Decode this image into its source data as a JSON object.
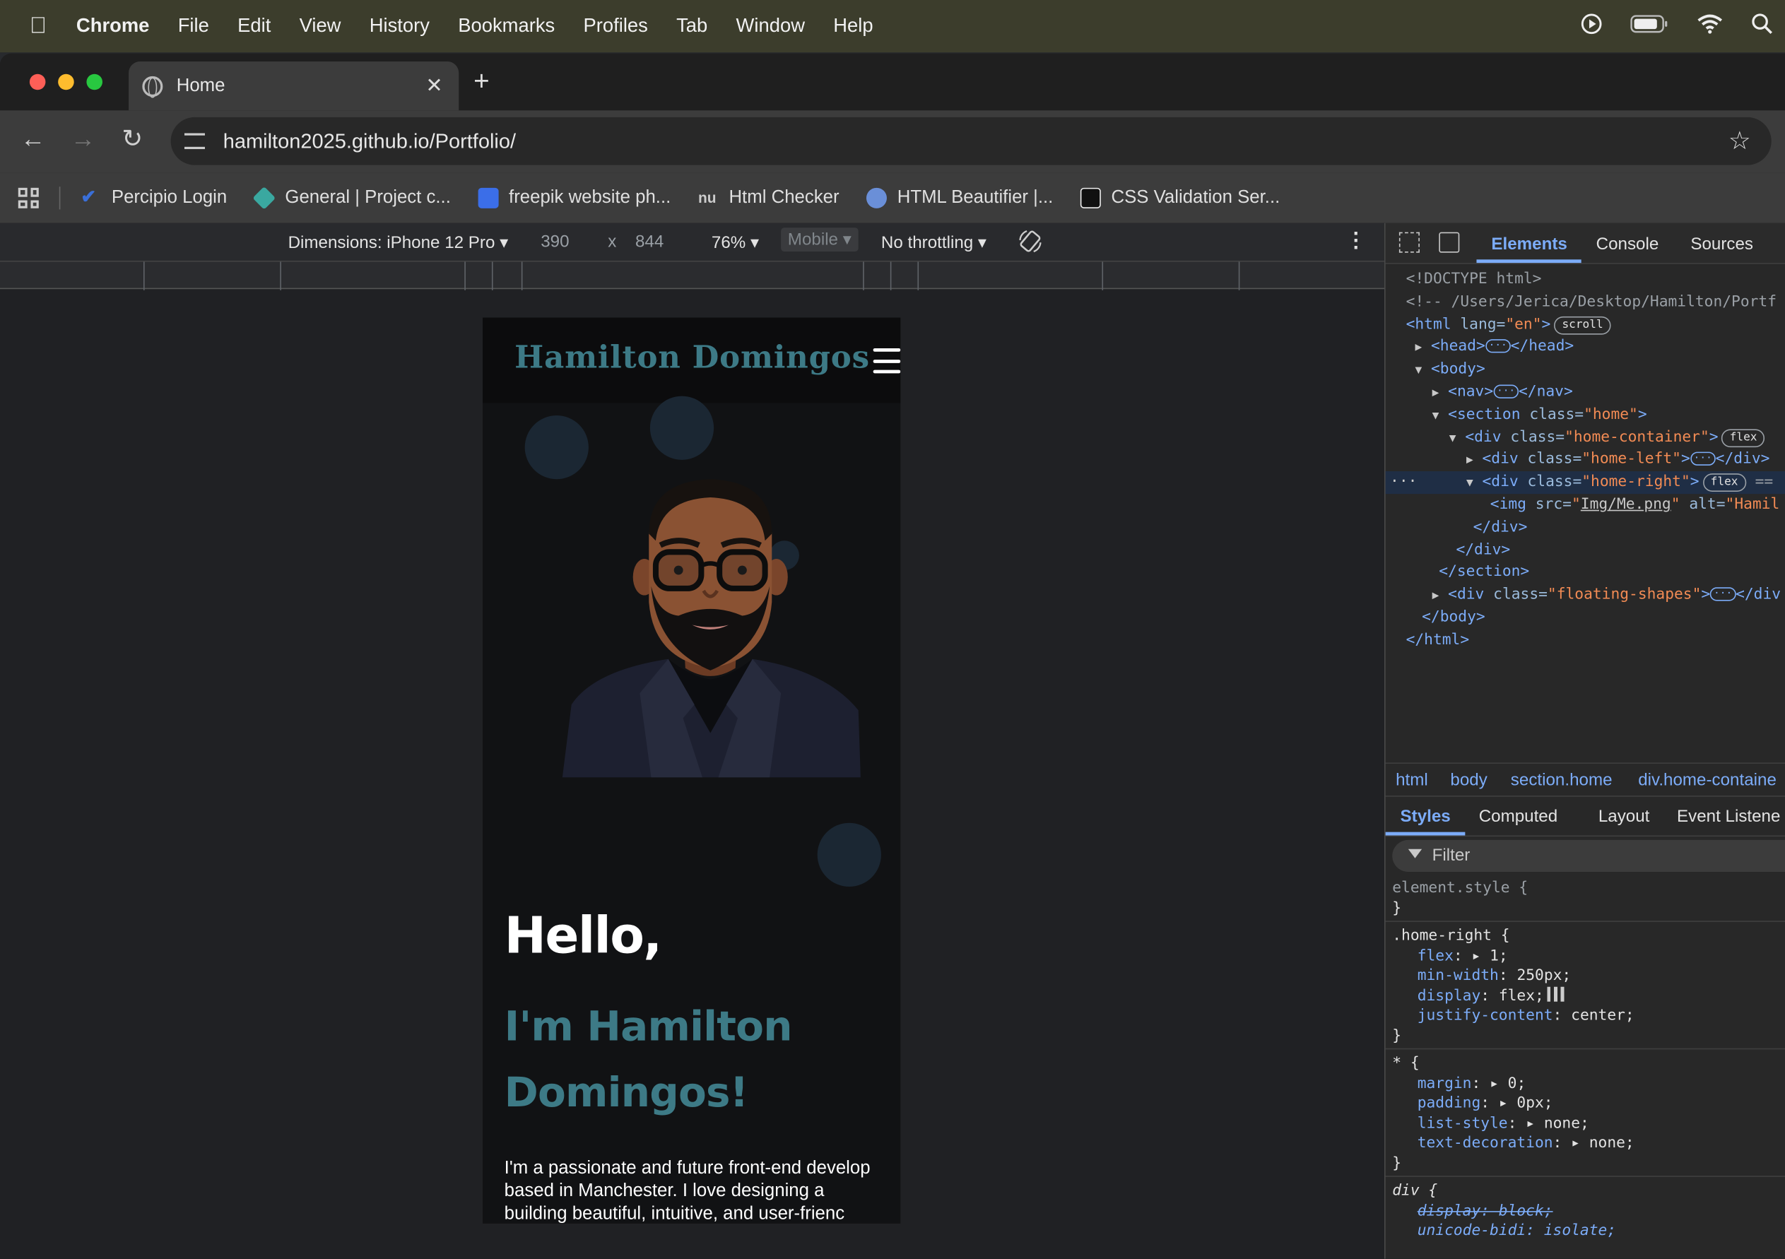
{
  "menubar": {
    "app": "Chrome",
    "items": [
      "File",
      "Edit",
      "View",
      "History",
      "Bookmarks",
      "Profiles",
      "Tab",
      "Window",
      "Help"
    ]
  },
  "tab": {
    "title": "Home"
  },
  "omnibox": {
    "url": "hamilton2025.github.io/Portfolio/"
  },
  "bookmarks": [
    {
      "label": "Percipio Login",
      "color": "#3a6fd8"
    },
    {
      "label": "General | Project c...",
      "color": "#3aa8a0"
    },
    {
      "label": "freepik website ph...",
      "color": "#3b6ee8"
    },
    {
      "label": "Html Checker",
      "color": "#1a1a2a"
    },
    {
      "label": "HTML Beautifier |...",
      "color": "#6a8fd8"
    },
    {
      "label": "CSS Validation Ser...",
      "color": "#111111"
    }
  ],
  "device_toolbar": {
    "dimensions_label": "Dimensions: iPhone 12 Pro",
    "width": "390",
    "times": "x",
    "height": "844",
    "zoom": "76%",
    "device_type": "Mobile",
    "throttling": "No throttling"
  },
  "page": {
    "logo": "Hamilton Domingos",
    "hello": "Hello,",
    "name_line": "I'm Hamilton Domingos!",
    "intro_lines": [
      "I'm a passionate and future front-end develop",
      "based in Manchester. I love designing a",
      "building beautiful, intuitive, and user-frienc"
    ],
    "accent_color": "#3d7a86"
  },
  "devtools": {
    "tabs": [
      "Elements",
      "Console",
      "Sources"
    ],
    "dom": {
      "doctype": "<!DOCTYPE html>",
      "comment": "<!-- /Users/Jerica/Desktop/Hamilton/Portf",
      "html_open": "<html",
      "html_attr": "lang",
      "html_val": "\"en\"",
      "html_end": ">",
      "scroll_badge": "scroll",
      "head": "<head>",
      "head_close": "</head>",
      "body_open": "<body>",
      "nav": "<nav>",
      "nav_close": "</nav>",
      "section_open": "<section",
      "section_attr": "class",
      "section_val": "\"home\"",
      "div_open": "<div",
      "div_attr": "class",
      "home_container_val": "\"home-container\"",
      "home_left_val": "\"home-left\"",
      "home_right_val": "\"home-right\"",
      "flex_badge": "flex",
      "div_close": "</div>",
      "eq": "==",
      "img_open": "<img",
      "img_src_attr": "src",
      "img_src_val": "Img/Me.png",
      "img_alt_attr": "alt",
      "img_alt_val": "\"Hamil",
      "section_close": "</section>",
      "floating_val": "\"floating-shapes\"",
      "div_close_cut": "</div",
      "body_close": "</body>",
      "html_close": "</html>",
      "gt": ">",
      "eqs": "=",
      "dots": "···"
    },
    "breadcrumbs": [
      "html",
      "body",
      "section.home",
      "div.home-containe"
    ],
    "style_tabs": [
      "Styles",
      "Computed",
      "Layout",
      "Event Listene"
    ],
    "filter_placeholder": "Filter",
    "css": {
      "element_style": "element.style {",
      "close": "}",
      "home_right_sel": ".home-right {",
      "flex_prop": "flex",
      "flex_val": "▸ 1;",
      "minw_prop": "min-width",
      "minw_val": "250px;",
      "display_prop": "display",
      "display_val": "flex;",
      "jc_prop": "justify-content",
      "jc_val": "center;",
      "star_sel": "* {",
      "margin_prop": "margin",
      "margin_val": "▸ 0;",
      "padding_prop": "padding",
      "padding_val": "▸ 0px;",
      "ls_prop": "list-style",
      "ls_val": "▸ none;",
      "td_prop": "text-decoration",
      "td_val": "▸ none;",
      "div_sel": "div {",
      "div_display": "display: block;",
      "unicode_bidi": "unicode-bidi: isolate;",
      "colon": ":"
    }
  }
}
